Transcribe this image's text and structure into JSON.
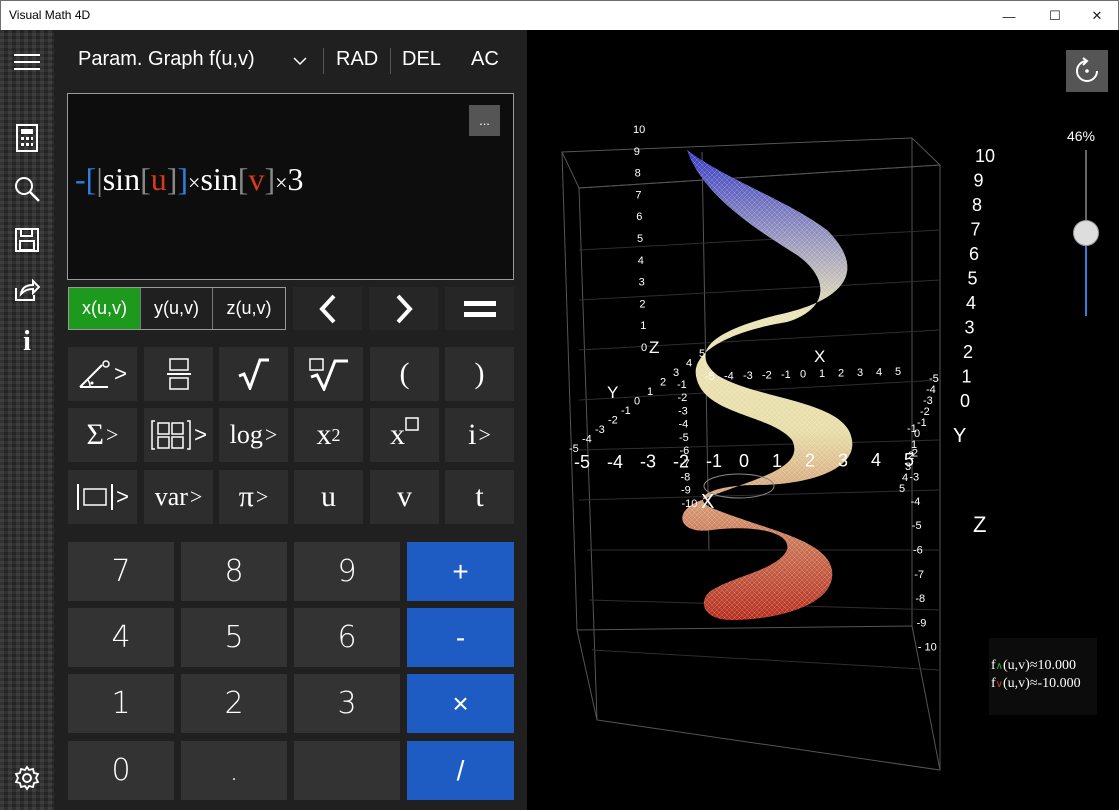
{
  "window": {
    "title": "Visual Math 4D",
    "minimize": "—",
    "maximize": "☐",
    "close": "✕"
  },
  "sidebar": {
    "items": [
      {
        "icon": "menu-icon"
      },
      {
        "icon": "calculator-icon"
      },
      {
        "icon": "search-icon"
      },
      {
        "icon": "save-icon"
      },
      {
        "icon": "share-icon"
      },
      {
        "icon": "info-icon",
        "glyph": "i"
      },
      {
        "icon": "settings-icon"
      }
    ]
  },
  "toolbar": {
    "mode": "Param. Graph f(u,v)",
    "angle": "RAD",
    "del": "DEL",
    "ac": "AC"
  },
  "editor": {
    "more": "...",
    "formula": {
      "minus": "-",
      "sin1": "sin",
      "u": "u",
      "times1": "×",
      "sin2": "sin",
      "v": "v",
      "times2": "×",
      "three": "3"
    }
  },
  "tabs": [
    {
      "label": "x(u,v)",
      "active": true
    },
    {
      "label": "y(u,v)"
    },
    {
      "label": "z(u,v)"
    }
  ],
  "nav": {
    "left": "<",
    "right": ">",
    "equals": "="
  },
  "functions": {
    "row1": {
      "paren_open": "(",
      "paren_close": ")"
    },
    "row2": {
      "sigma": "Σ",
      "log": "log",
      "x2": "x",
      "x2_sup": "2",
      "xbox": "x",
      "i": "i"
    },
    "row3": {
      "var": "var",
      "pi": "π",
      "u": "u",
      "v": "v",
      "t": "t"
    }
  },
  "numpad": {
    "keys": [
      "7",
      "8",
      "9",
      "+",
      "4",
      "5",
      "6",
      "-",
      "1",
      "2",
      "3",
      "×",
      "0",
      ".",
      "",
      "/"
    ]
  },
  "view": {
    "zoom": "46%",
    "zoom_value": 0.46,
    "fmax": "(u,v)≈10.000",
    "fmin": "(u,v)≈-10.000",
    "fmax_prefix": "f",
    "fmin_prefix": "f",
    "fmax_arrow": "∧",
    "fmin_arrow": "∨",
    "axis_labels": {
      "x_back": "X",
      "x_front": "X",
      "y_left": "Y",
      "y_right": "Y",
      "z_left": "Z",
      "z_right": "Z"
    },
    "z_ticks_right": [
      "10",
      "9",
      "8",
      "7",
      "6",
      "5",
      "4",
      "3",
      "2",
      "1",
      "0",
      "-1",
      "-2",
      "-3",
      "-4",
      "-5",
      "-6",
      "-7",
      "-8",
      "-9",
      "- 10"
    ],
    "z_ticks_left": [
      "10",
      "9",
      "8",
      "7",
      "6",
      "5",
      "4",
      "3",
      "2",
      "1",
      "0",
      "-1",
      "-2",
      "-3",
      "-4",
      "-5",
      "-6",
      "-7",
      "-8",
      "-9",
      "-10"
    ],
    "x_ticks": [
      "-5",
      "-4",
      "-3",
      "-2",
      "-1",
      "0",
      "1",
      "2",
      "3",
      "4",
      "5"
    ],
    "y_ticks": [
      "-5",
      "-4",
      "-3",
      "-2",
      "-1",
      "0",
      "1",
      "2",
      "3",
      "4",
      "5"
    ],
    "colors": {
      "top": "#3b3fd0",
      "mid": "#f6f0c0",
      "bottom": "#c03020",
      "accent": "#1e5cc4",
      "active_tab": "#1d9a1d"
    }
  }
}
